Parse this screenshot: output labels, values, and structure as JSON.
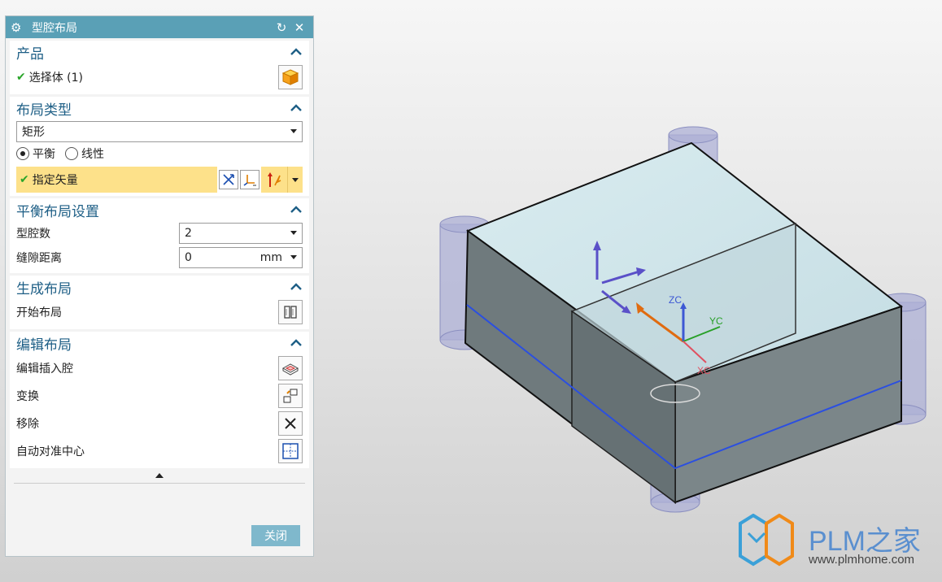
{
  "dialog": {
    "title": "型腔布局",
    "product": {
      "title": "产品",
      "select_body_label": "选择体 (1)"
    },
    "layout_type": {
      "title": "布局类型",
      "type_value": "矩形",
      "radio_balanced": "平衡",
      "radio_linear": "线性",
      "selected_radio": "平衡",
      "specify_vector": "指定矢量"
    },
    "balanced_settings": {
      "title": "平衡布局设置",
      "cavity_count_label": "型腔数",
      "cavity_count_value": "2",
      "gap_label": "缝隙距离",
      "gap_value": "0",
      "gap_unit": "mm"
    },
    "generate": {
      "title": "生成布局",
      "start_layout": "开始布局"
    },
    "edit": {
      "title": "编辑布局",
      "edit_insert": "编辑插入腔",
      "transform": "变换",
      "remove": "移除",
      "auto_center": "自动对准中心"
    },
    "close_label": "关闭"
  },
  "viewport": {
    "axis_zc": "ZC",
    "axis_yc": "YC",
    "axis_xc": "XC"
  },
  "watermark": {
    "brand": "PLM之家",
    "url": "www.plmhome.com"
  },
  "colors": {
    "title_bar": "#5aa0b6",
    "section_title": "#1e5f86",
    "highlight": "#fde18a",
    "close_button": "#7fb8cc"
  }
}
